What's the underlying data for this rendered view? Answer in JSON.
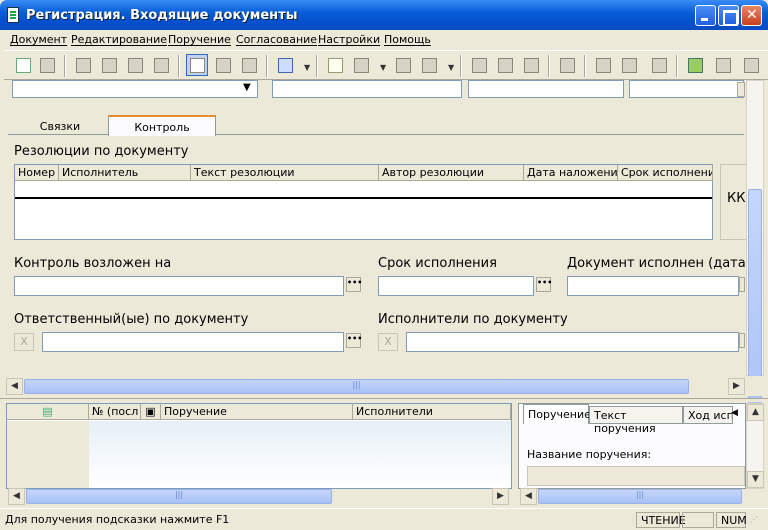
{
  "window": {
    "title": "Регистрация. Входящие документы"
  },
  "menu": [
    "Документ",
    "Редактирование",
    "Поручение",
    "Согласование",
    "Настройки",
    "Помощь"
  ],
  "tabs": {
    "links": "Связки",
    "control": "Контроль"
  },
  "resolutions": {
    "title": "Резолюции по документу",
    "columns": [
      "Номер",
      "Исполнитель",
      "Текст резолюции",
      "Автор резолюции",
      "Дата наложения",
      "Срок исполнения"
    ],
    "side_button": "КК"
  },
  "form": {
    "control_label": "Контроль возложен на",
    "deadline_label": "Срок исполнения",
    "executed_label": "Документ исполнен (дата)",
    "responsible_label": "Ответственный(ые) по документу",
    "executors_label": "Исполнители по документу",
    "x_label": "X",
    "ellipsis": "•••"
  },
  "bottom_grid": {
    "columns": [
      "",
      "№ (посл",
      "",
      "Поручение",
      "Исполнители"
    ]
  },
  "bottom_tabs": [
    "Поручение",
    "Текст поручения",
    "Ход исп"
  ],
  "order_name_label": "Название поручения:",
  "status": {
    "hint": "Для получения подсказки нажмите F1",
    "mode": "ЧТЕНИЕ",
    "num": "NUM"
  },
  "icons": [
    "new-document-icon",
    "save-icon",
    "toolbar-icon",
    "attach-icon",
    "print-icon",
    "filter-icon",
    "arrow-icon",
    "scroll-icon"
  ]
}
